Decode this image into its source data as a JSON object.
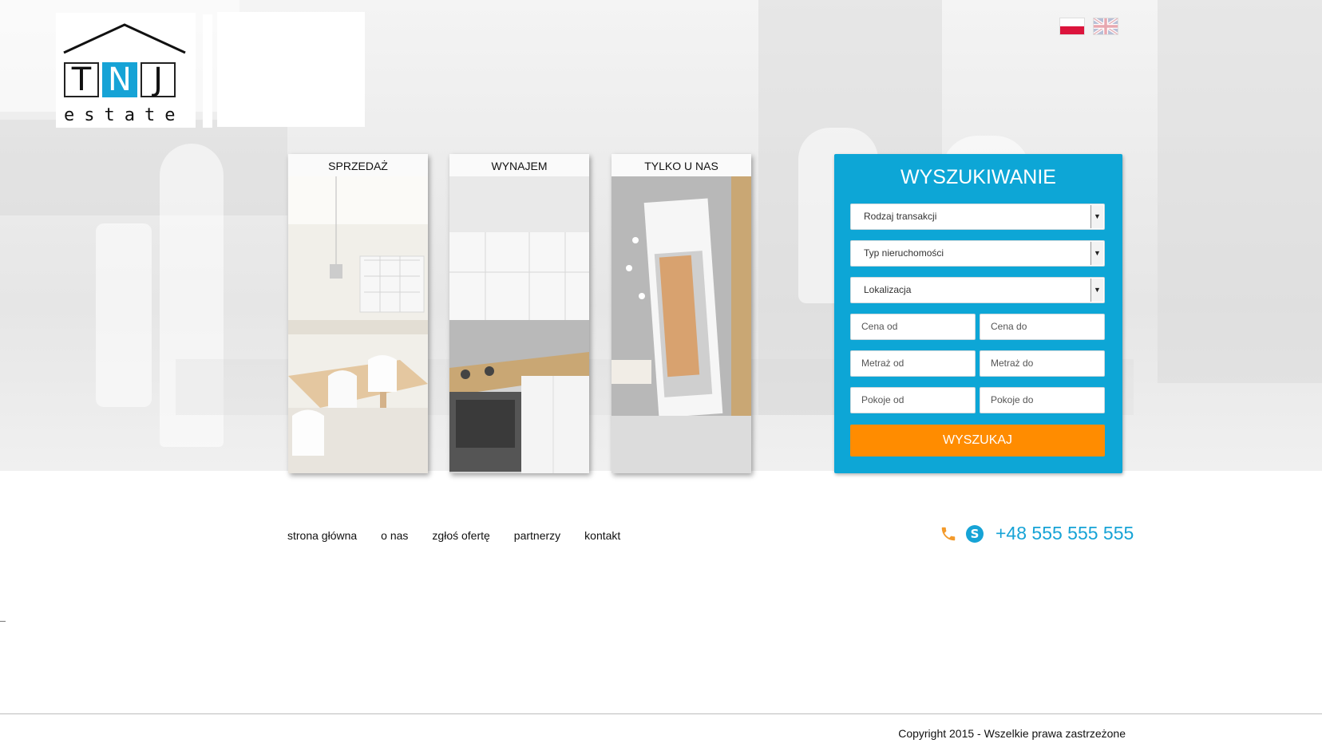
{
  "brand": {
    "logo_letters": [
      "T",
      "N",
      "J"
    ],
    "logo_word": "estate",
    "accent_color": "#16a3d6"
  },
  "languages": [
    {
      "code": "pl",
      "icon": "flag-pl-icon"
    },
    {
      "code": "en",
      "icon": "flag-en-icon"
    }
  ],
  "cards": [
    {
      "label": "SPRZEDAŻ"
    },
    {
      "label": "WYNAJEM"
    },
    {
      "label": "TYLKO U NAS"
    }
  ],
  "search": {
    "title": "WYSZUKIWANIE",
    "panel_color": "#0da6d6",
    "transaction_type": "Rodzaj transakcji",
    "property_type": "Typ nieruchomości",
    "location": "Lokalizacja",
    "price_from": "Cena od",
    "price_to": "Cena do",
    "area_from": "Metraż od",
    "area_to": "Metraż do",
    "rooms_from": "Pokoje od",
    "rooms_to": "Pokoje do",
    "submit": "WYSZUKAJ",
    "submit_color": "#ff8c00"
  },
  "nav": {
    "home": "strona główna",
    "about": "o nas",
    "submit_offer": "zgłoś ofertę",
    "partners": "partnerzy",
    "contact": "kontakt"
  },
  "contact": {
    "phone_icon": "phone-icon",
    "skype_icon": "skype-icon",
    "phone": "+48 555 555 555"
  },
  "footer": {
    "copyright": "Copyright 2015 - Wszelkie prawa zastrzeżone"
  }
}
